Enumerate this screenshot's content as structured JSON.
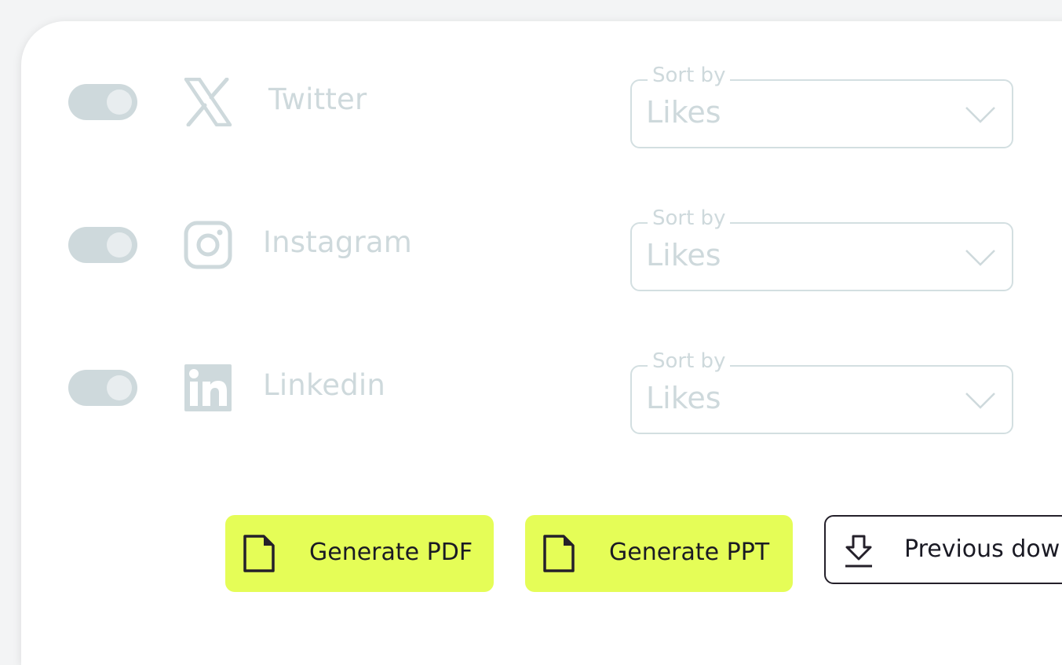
{
  "platforms": [
    {
      "name": "Twitter",
      "icon": "x-twitter-icon",
      "sort_label": "Sort by",
      "sort_value": "Likes",
      "enabled": true
    },
    {
      "name": "Instagram",
      "icon": "instagram-icon",
      "sort_label": "Sort by",
      "sort_value": "Likes",
      "enabled": true
    },
    {
      "name": "Linkedin",
      "icon": "linkedin-icon",
      "sort_label": "Sort by",
      "sort_value": "Likes",
      "enabled": true
    }
  ],
  "actions": {
    "generate_pdf": "Generate PDF",
    "generate_ppt": "Generate PPT",
    "previous_downloads": "Previous dow"
  },
  "colors": {
    "accent": "#e5fd57",
    "disabled": "#ced9dc",
    "text_dark": "#1a1a24"
  }
}
